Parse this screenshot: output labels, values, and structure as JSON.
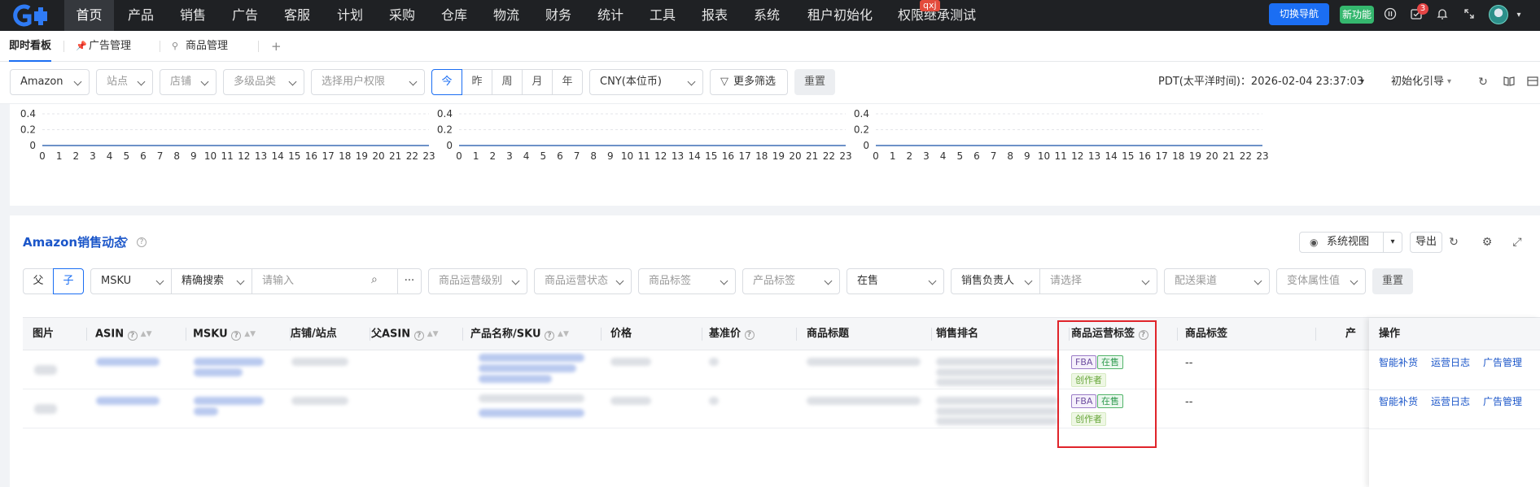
{
  "topnav": {
    "items": [
      "首页",
      "产品",
      "销售",
      "广告",
      "客服",
      "计划",
      "采购",
      "仓库",
      "物流",
      "财务",
      "统计",
      "工具",
      "报表",
      "系统",
      "租户初始化",
      "权限继承测试"
    ],
    "badge_qxj": "qxj",
    "switch_nav": "切换导航",
    "new_feature": "新功能",
    "message_count": "3"
  },
  "tabs": {
    "items": [
      "即时看板",
      "广告管理",
      "商品管理"
    ],
    "add": "+"
  },
  "toolbar": {
    "platform": "Amazon",
    "site_placeholder": "站点",
    "shop_placeholder": "店铺",
    "category_placeholder": "多级品类",
    "user_perm_placeholder": "选择用户权限",
    "periods": [
      "今",
      "昨",
      "周",
      "月",
      "年"
    ],
    "currency": "CNY(本位币)",
    "more_filter": "更多筛选",
    "reset": "重置",
    "timezone": "PDT(太平洋时间)：2026-02-04 23:37:03",
    "init_guide": "初始化引导"
  },
  "charts": {
    "y_ticks": [
      "0.4",
      "0.2",
      "0"
    ],
    "x_ticks": [
      "0",
      "1",
      "2",
      "3",
      "4",
      "5",
      "6",
      "7",
      "8",
      "9",
      "10",
      "11",
      "12",
      "13",
      "14",
      "15",
      "16",
      "17",
      "18",
      "19",
      "20",
      "21",
      "22",
      "23"
    ]
  },
  "chart_data": [
    {
      "type": "line",
      "x": [
        0,
        1,
        2,
        3,
        4,
        5,
        6,
        7,
        8,
        9,
        10,
        11,
        12,
        13,
        14,
        15,
        16,
        17,
        18,
        19,
        20,
        21,
        22,
        23
      ],
      "series": [
        {
          "values": [
            0,
            0,
            0,
            0,
            0,
            0,
            0,
            0,
            0,
            0,
            0,
            0,
            0,
            0,
            0,
            0,
            0,
            0,
            0,
            0,
            0,
            0,
            0,
            0
          ]
        }
      ],
      "ylim": [
        0,
        0.4
      ],
      "grid": true
    },
    {
      "type": "line",
      "x": [
        0,
        1,
        2,
        3,
        4,
        5,
        6,
        7,
        8,
        9,
        10,
        11,
        12,
        13,
        14,
        15,
        16,
        17,
        18,
        19,
        20,
        21,
        22,
        23
      ],
      "series": [
        {
          "values": [
            0,
            0,
            0,
            0,
            0,
            0,
            0,
            0,
            0,
            0,
            0,
            0,
            0,
            0,
            0,
            0,
            0,
            0,
            0,
            0,
            0,
            0,
            0,
            0
          ]
        }
      ],
      "ylim": [
        0,
        0.4
      ],
      "grid": true
    },
    {
      "type": "line",
      "x": [
        0,
        1,
        2,
        3,
        4,
        5,
        6,
        7,
        8,
        9,
        10,
        11,
        12,
        13,
        14,
        15,
        16,
        17,
        18,
        19,
        20,
        21,
        22,
        23
      ],
      "series": [
        {
          "values": [
            0,
            0,
            0,
            0,
            0,
            0,
            0,
            0,
            0,
            0,
            0,
            0,
            0,
            0,
            0,
            0,
            0,
            0,
            0,
            0,
            0,
            0,
            0,
            0
          ]
        }
      ],
      "ylim": [
        0,
        0.4
      ],
      "grid": true
    }
  ],
  "sales": {
    "title": "Amazon销售动态",
    "system_view": "系统视图",
    "export": "导出",
    "parent": "父",
    "child": "子",
    "msku": "MSKU",
    "exact_search": "精确搜索",
    "search_placeholder": "请输入",
    "more": "···",
    "op_level_placeholder": "商品运营级别",
    "op_status_placeholder": "商品运营状态",
    "goods_tag_placeholder": "商品标签",
    "product_tag_placeholder": "产品标签",
    "on_sale": "在售",
    "owner": "销售负责人",
    "owner_placeholder": "请选择",
    "delivery_placeholder": "配送渠道",
    "variant_placeholder": "变体属性值",
    "reset": "重置"
  },
  "table": {
    "columns": [
      "图片",
      "ASIN",
      "MSKU",
      "店铺/站点",
      "父ASIN",
      "产品名称/SKU",
      "价格",
      "基准价",
      "商品标题",
      "销售排名",
      "商品运营标签",
      "商品标签",
      "产",
      "操作"
    ],
    "rows": [
      {
        "tags": [
          "FBA",
          "在售",
          "创作者"
        ],
        "goods_tag": "--",
        "ops": [
          "智能补货",
          "运营日志",
          "广告管理"
        ]
      },
      {
        "tags": [
          "FBA",
          "在售",
          "创作者"
        ],
        "goods_tag": "--",
        "ops": [
          "智能补货",
          "运营日志",
          "广告管理"
        ]
      }
    ]
  },
  "colors": {
    "brand": "#1b6ef3",
    "highlight_box": "#e0242a",
    "nav_bg": "#1f2124"
  }
}
